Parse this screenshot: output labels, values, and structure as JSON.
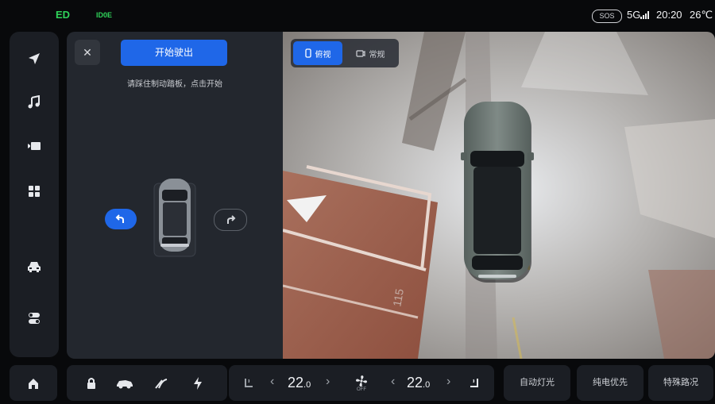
{
  "statusbar": {
    "gear": "ED",
    "light_indicator": "ID0E",
    "sos": "SOS",
    "network": "5G",
    "time": "20:20",
    "temperature": "26℃"
  },
  "sidebar": {
    "items": [
      {
        "name": "navigation",
        "icon": "navigation-arrow-icon"
      },
      {
        "name": "music",
        "icon": "music-note-icon"
      },
      {
        "name": "video",
        "icon": "video-camera-icon"
      },
      {
        "name": "apps",
        "icon": "app-grid-icon"
      },
      {
        "name": "vehicle",
        "icon": "car-icon"
      },
      {
        "name": "controls",
        "icon": "toggle-icon"
      }
    ]
  },
  "parking_panel": {
    "close_icon": "close-icon",
    "start_button": "开始驶出",
    "hint": "请踩住制动踏板，点击开始",
    "left_direction": "turn-left-arrow-icon",
    "right_direction": "turn-right-arrow-icon"
  },
  "camera": {
    "tabs": [
      {
        "label": "俯视",
        "icon": "phone-portrait-icon",
        "active": true
      },
      {
        "label": "常规",
        "icon": "camera-icon",
        "active": false
      }
    ],
    "floor_marking": "115"
  },
  "dock": {
    "home_icon": "home-icon",
    "vehicle_icons": [
      "lock-icon",
      "car-side-icon",
      "wiper-icon",
      "charging-icon"
    ],
    "left_seat_icon": "seat-heat-left-icon",
    "left_temp_int": "22",
    "left_temp_dec": ".0",
    "fan_label": "OFF",
    "right_temp_int": "22",
    "right_temp_dec": ".0",
    "right_seat_icon": "seat-heat-right-icon",
    "quick_actions": [
      "自动灯光",
      "纯电优先",
      "特殊路况"
    ]
  },
  "colors": {
    "accent": "#1f67e8",
    "indicator_green": "#2fd35a",
    "panel": "#23272e",
    "sidebar": "#1b1e24"
  }
}
